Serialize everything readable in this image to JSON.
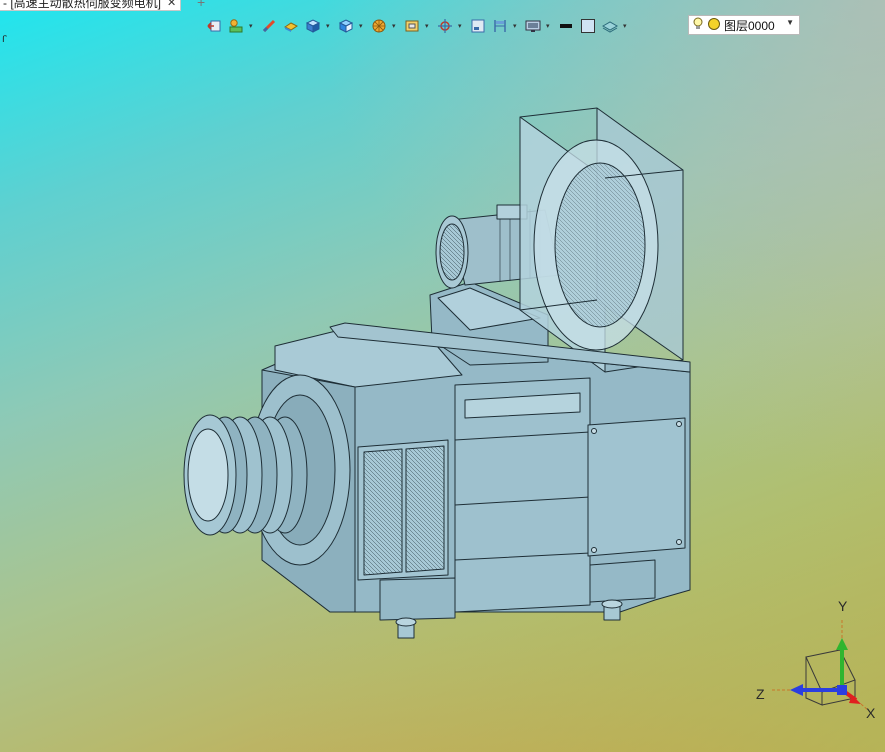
{
  "document_tab": {
    "title": "- [高速主动散热伺服变频电机]",
    "close_glyph": "✕",
    "new_tab_glyph": "+"
  },
  "corner_mark": "ꓩ",
  "toolbar": {
    "icons": [
      "view-back-icon",
      "display-mode-icon",
      "line-tool-icon",
      "face-shade-icon",
      "solid-box-icon",
      "view-cube-icon",
      "section-icon",
      "sheet-icon",
      "snap-target-icon",
      "frame-icon",
      "dimension-icon",
      "screen-icon",
      "line-weight-icon",
      "color-swatch-icon",
      "layer-manager-icon"
    ]
  },
  "layer_selector": {
    "value": "图层0000",
    "bulb_color": "#f6e74a",
    "sun_color": "#f3d22a"
  },
  "axis_triad": {
    "x_label": "X",
    "y_label": "Y",
    "z_label": "Z",
    "x_color": "#e02020",
    "y_color": "#2fb52f",
    "z_color": "#2a3ee0"
  },
  "model": {
    "body_color": "#95b9c7",
    "edge_color": "#1e2e36"
  }
}
